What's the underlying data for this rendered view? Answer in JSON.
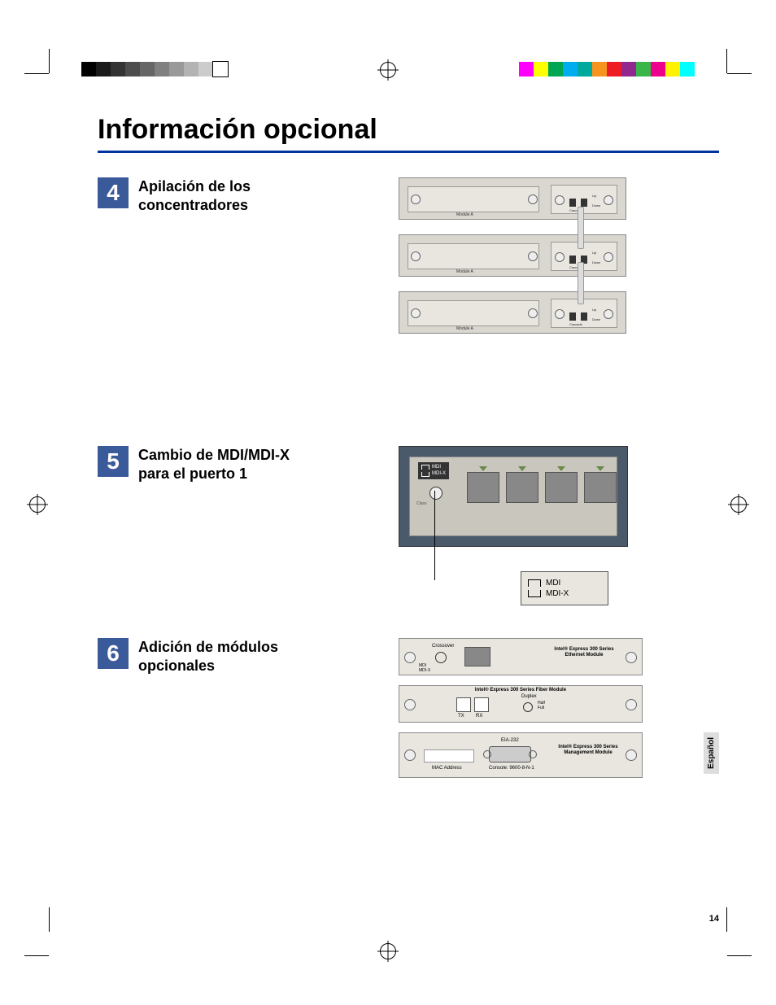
{
  "title": "Información opcional",
  "sections": {
    "s4": {
      "num": "4",
      "title": "Apilación de los concentradores"
    },
    "s5": {
      "num": "5",
      "title": "Cambio de MDI/MDI-X para el puerto 1"
    },
    "s6": {
      "num": "6",
      "title": "Adición de módulos opcionales"
    }
  },
  "hub": {
    "module_label": "Module A",
    "port_up": "Up",
    "port_down": "Down",
    "cascade": "Cascade"
  },
  "mdi": {
    "label_mdi": "MDI",
    "label_mdix": "MDI-X",
    "class": "Class"
  },
  "legend": {
    "mdi": "MDI",
    "mdix": "MDI-X"
  },
  "modules": {
    "ethernet": {
      "title": "Intel® Express 300 Series\nEthernet Module",
      "crossover": "Crossover",
      "mdi": "MDI",
      "mdix": "MDI-X"
    },
    "fiber": {
      "title": "Intel® Express 300 Series Fiber Module",
      "tx": "TX",
      "rx": "RX",
      "duplex": "Duplex",
      "half": "Half",
      "full": "Full"
    },
    "mgmt": {
      "title": "Intel® Express 300 Series\nManagement Module",
      "eia": "EIA-232",
      "mac": "MAC Address",
      "console": "Console: 9600-8-N-1"
    }
  },
  "language_tab": "Español",
  "page_number": "14",
  "colorbar_left": [
    "#000000",
    "#1a1a1a",
    "#333333",
    "#4d4d4d",
    "#666666",
    "#808080",
    "#999999",
    "#b3b3b3",
    "#cccccc",
    "#ffffff"
  ],
  "colorbar_right": [
    "#ff00ff",
    "#ffff00",
    "#00a651",
    "#00aeef",
    "#00a99d",
    "#f7941d",
    "#ed1c24",
    "#92278f",
    "#39b54a",
    "#ec008c",
    "#fff200",
    "#00ffff"
  ]
}
